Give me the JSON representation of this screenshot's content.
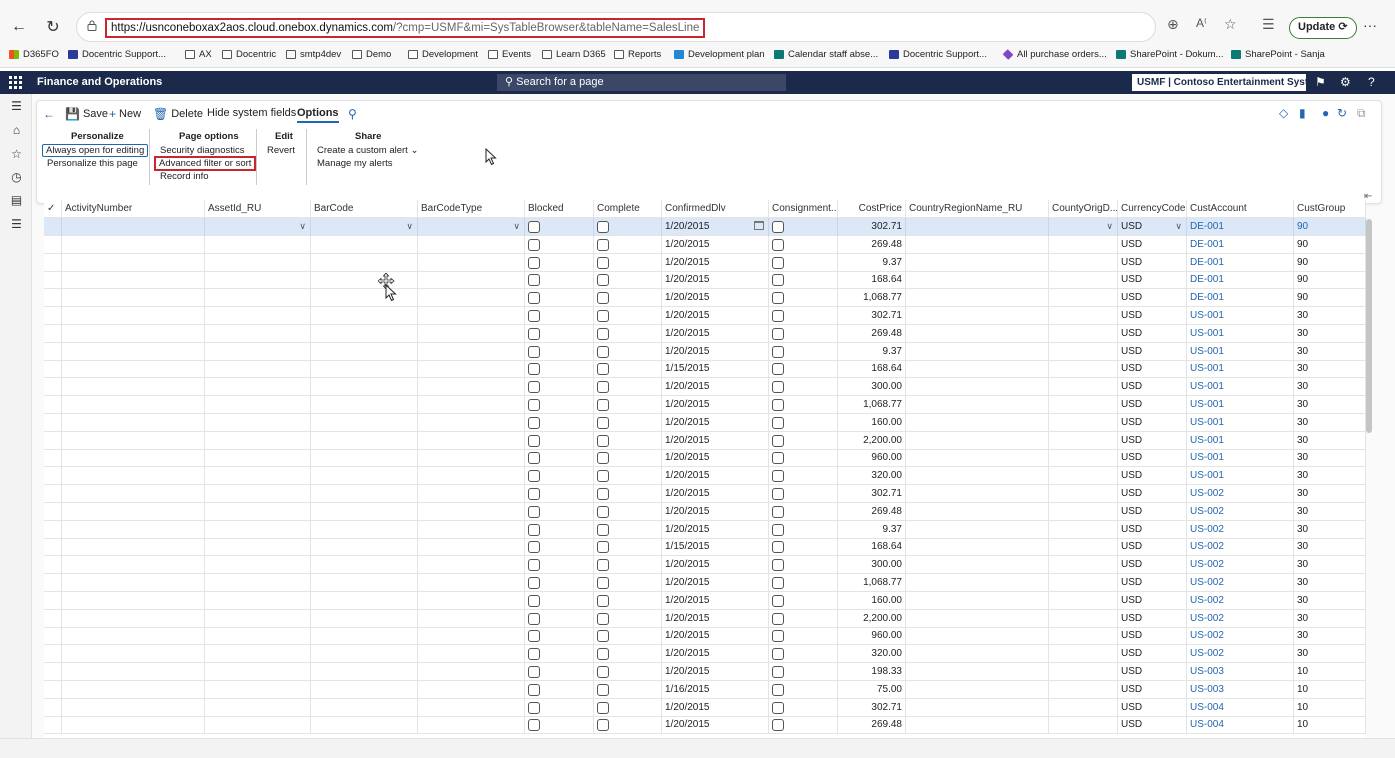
{
  "browser": {
    "url_host": "https://usnconeboxax2aos.cloud.onebox.dynamics.com",
    "url_rest": "/?cmp=USMF&mi=SysTableBrowser&tableName=SalesLine",
    "update_label": "Update",
    "bookmarks": [
      {
        "label": "D365FO",
        "icon": "microsoft-icon"
      },
      {
        "label": "Docentric Support...",
        "icon": "docentric-icon"
      },
      {
        "label": "AX",
        "icon": "folder-icon"
      },
      {
        "label": "Docentric",
        "icon": "folder-icon"
      },
      {
        "label": "smtp4dev",
        "icon": "globe-icon"
      },
      {
        "label": "Demo",
        "icon": "folder-icon"
      },
      {
        "label": "Development",
        "icon": "folder-icon"
      },
      {
        "label": "Events",
        "icon": "folder-icon"
      },
      {
        "label": "Learn D365",
        "icon": "folder-icon"
      },
      {
        "label": "Reports",
        "icon": "folder-icon"
      },
      {
        "label": "Development plan",
        "icon": "devops-icon"
      },
      {
        "label": "Calendar staff abse...",
        "icon": "sharepoint-icon"
      },
      {
        "label": "Docentric Support...",
        "icon": "docentric-icon"
      },
      {
        "label": "All purchase orders...",
        "icon": "powerapps-icon"
      },
      {
        "label": "SharePoint - Dokum...",
        "icon": "sharepoint-icon"
      },
      {
        "label": "SharePoint - Sanja",
        "icon": "sharepoint-icon"
      }
    ]
  },
  "header": {
    "app_title": "Finance and Operations",
    "search_placeholder": "Search for a page",
    "company": "USMF | Contoso Entertainment Syste..."
  },
  "action_pane": {
    "save": "Save",
    "new": "New",
    "delete": "Delete",
    "hide_system_fields": "Hide system fields",
    "options": "Options"
  },
  "groups": {
    "personalize": {
      "title": "Personalize",
      "items": [
        "Always open for editing",
        "Personalize this page"
      ]
    },
    "page_options": {
      "title": "Page options",
      "items": [
        "Security diagnostics",
        "Advanced filter or sort",
        "Record info"
      ]
    },
    "edit": {
      "title": "Edit",
      "items": [
        "Revert"
      ]
    },
    "share": {
      "title": "Share",
      "items": [
        "Create a custom alert",
        "Manage my alerts"
      ]
    }
  },
  "grid": {
    "columns": [
      "ActivityNumber",
      "AssetId_RU",
      "BarCode",
      "BarCodeType",
      "Blocked",
      "Complete",
      "ConfirmedDlv",
      "Consignment...",
      "CostPrice",
      "CountryRegionName_RU",
      "CountyOrigD...",
      "CurrencyCode",
      "CustAccount",
      "CustGroup"
    ],
    "rows": [
      {
        "date": "1/20/2015",
        "cost": "302.71",
        "currency": "USD",
        "account": "DE-001",
        "group": "90"
      },
      {
        "date": "1/20/2015",
        "cost": "269.48",
        "currency": "USD",
        "account": "DE-001",
        "group": "90"
      },
      {
        "date": "1/20/2015",
        "cost": "9.37",
        "currency": "USD",
        "account": "DE-001",
        "group": "90"
      },
      {
        "date": "1/20/2015",
        "cost": "168.64",
        "currency": "USD",
        "account": "DE-001",
        "group": "90"
      },
      {
        "date": "1/20/2015",
        "cost": "1,068.77",
        "currency": "USD",
        "account": "DE-001",
        "group": "90"
      },
      {
        "date": "1/20/2015",
        "cost": "302.71",
        "currency": "USD",
        "account": "US-001",
        "group": "30"
      },
      {
        "date": "1/20/2015",
        "cost": "269.48",
        "currency": "USD",
        "account": "US-001",
        "group": "30"
      },
      {
        "date": "1/20/2015",
        "cost": "9.37",
        "currency": "USD",
        "account": "US-001",
        "group": "30"
      },
      {
        "date": "1/15/2015",
        "cost": "168.64",
        "currency": "USD",
        "account": "US-001",
        "group": "30"
      },
      {
        "date": "1/20/2015",
        "cost": "300.00",
        "currency": "USD",
        "account": "US-001",
        "group": "30"
      },
      {
        "date": "1/20/2015",
        "cost": "1,068.77",
        "currency": "USD",
        "account": "US-001",
        "group": "30"
      },
      {
        "date": "1/20/2015",
        "cost": "160.00",
        "currency": "USD",
        "account": "US-001",
        "group": "30"
      },
      {
        "date": "1/20/2015",
        "cost": "2,200.00",
        "currency": "USD",
        "account": "US-001",
        "group": "30"
      },
      {
        "date": "1/20/2015",
        "cost": "960.00",
        "currency": "USD",
        "account": "US-001",
        "group": "30"
      },
      {
        "date": "1/20/2015",
        "cost": "320.00",
        "currency": "USD",
        "account": "US-001",
        "group": "30"
      },
      {
        "date": "1/20/2015",
        "cost": "302.71",
        "currency": "USD",
        "account": "US-002",
        "group": "30"
      },
      {
        "date": "1/20/2015",
        "cost": "269.48",
        "currency": "USD",
        "account": "US-002",
        "group": "30"
      },
      {
        "date": "1/20/2015",
        "cost": "9.37",
        "currency": "USD",
        "account": "US-002",
        "group": "30"
      },
      {
        "date": "1/15/2015",
        "cost": "168.64",
        "currency": "USD",
        "account": "US-002",
        "group": "30"
      },
      {
        "date": "1/20/2015",
        "cost": "300.00",
        "currency": "USD",
        "account": "US-002",
        "group": "30"
      },
      {
        "date": "1/20/2015",
        "cost": "1,068.77",
        "currency": "USD",
        "account": "US-002",
        "group": "30"
      },
      {
        "date": "1/20/2015",
        "cost": "160.00",
        "currency": "USD",
        "account": "US-002",
        "group": "30"
      },
      {
        "date": "1/20/2015",
        "cost": "2,200.00",
        "currency": "USD",
        "account": "US-002",
        "group": "30"
      },
      {
        "date": "1/20/2015",
        "cost": "960.00",
        "currency": "USD",
        "account": "US-002",
        "group": "30"
      },
      {
        "date": "1/20/2015",
        "cost": "320.00",
        "currency": "USD",
        "account": "US-002",
        "group": "30"
      },
      {
        "date": "1/20/2015",
        "cost": "198.33",
        "currency": "USD",
        "account": "US-003",
        "group": "10"
      },
      {
        "date": "1/16/2015",
        "cost": "75.00",
        "currency": "USD",
        "account": "US-003",
        "group": "10"
      },
      {
        "date": "1/20/2015",
        "cost": "302.71",
        "currency": "USD",
        "account": "US-004",
        "group": "10"
      },
      {
        "date": "1/20/2015",
        "cost": "269.48",
        "currency": "USD",
        "account": "US-004",
        "group": "10"
      }
    ]
  },
  "colors": {
    "header_bg": "#1b2a4a",
    "accent": "#2266b0",
    "highlight_border": "#c8272f",
    "selected_row": "#dce8f7"
  }
}
